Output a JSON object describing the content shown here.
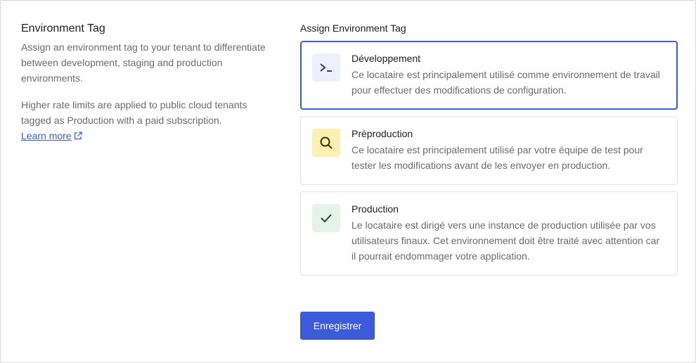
{
  "left": {
    "title": "Environment Tag",
    "desc1": "Assign an environment tag to your tenant to differentiate between development, staging and production environments.",
    "desc2": "Higher rate limits are applied to public cloud tenants tagged as Production with a paid subscription.",
    "learn_more": "Learn more"
  },
  "right": {
    "label": "Assign Environment Tag",
    "options": [
      {
        "title": "Développement",
        "desc": "Ce locataire est principalement utilisé comme environnement de travail pour effectuer des modifications de configuration.",
        "icon": "terminal-icon",
        "icon_bg": "#eef0fb",
        "selected": true
      },
      {
        "title": "Préproduction",
        "desc": "Ce locataire est principalement utilisé par votre équipe de test pour tester les modifications avant de les envoyer en production.",
        "icon": "search-icon",
        "icon_bg": "#fdf0b3",
        "selected": false
      },
      {
        "title": "Production",
        "desc": "Le locataire est dirigé vers une instance de production utilisée par vos utilisateurs finaux. Cet environnement doit être traité avec attention car il pourrait endommager votre application.",
        "icon": "check-icon",
        "icon_bg": "#e5f3ea",
        "selected": false
      }
    ]
  },
  "save_label": "Enregistrer",
  "accent": "#3b5bdb"
}
